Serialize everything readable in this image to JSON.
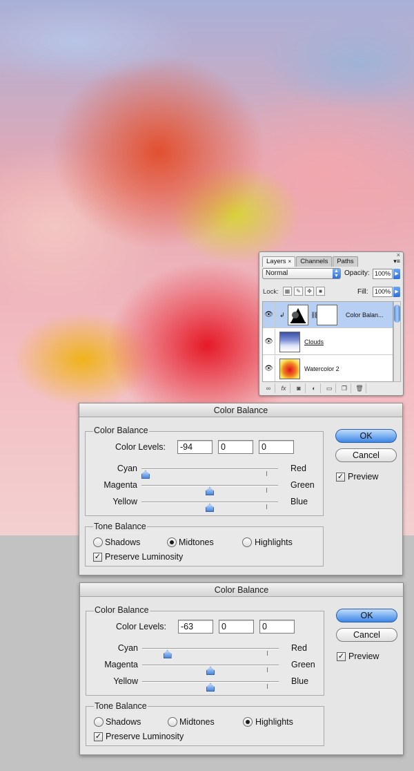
{
  "layers_panel": {
    "tabs": [
      "Layers",
      "Channels",
      "Paths"
    ],
    "tab_close": "×",
    "menu": "▾≡",
    "close": "×",
    "blend_mode": "Normal",
    "opacity_label": "Opacity:",
    "opacity_value": "100%",
    "lock_label": "Lock:",
    "fill_label": "Fill:",
    "fill_value": "100%",
    "layers": [
      {
        "name": "Color Balan...",
        "selected": true
      },
      {
        "name": "Clouds",
        "selected": false
      },
      {
        "name": "Watercolor 2",
        "selected": false
      }
    ]
  },
  "dialogs": [
    {
      "title": "Color Balance",
      "group_label": "Color Balance",
      "levels_label": "Color Levels:",
      "levels": [
        "-94",
        "0",
        "0"
      ],
      "sliders": [
        {
          "left": "Cyan",
          "right": "Red",
          "value": -94
        },
        {
          "left": "Magenta",
          "right": "Green",
          "value": 0
        },
        {
          "left": "Yellow",
          "right": "Blue",
          "value": 0
        }
      ],
      "ok_label": "OK",
      "cancel_label": "Cancel",
      "preview_label": "Preview",
      "preview_checked": true,
      "tone_label": "Tone Balance",
      "tones": [
        "Shadows",
        "Midtones",
        "Highlights"
      ],
      "selected_tone": "Midtones",
      "preserve_label": "Preserve Luminosity",
      "preserve_checked": true
    },
    {
      "title": "Color Balance",
      "group_label": "Color Balance",
      "levels_label": "Color Levels:",
      "levels": [
        "-63",
        "0",
        "0"
      ],
      "sliders": [
        {
          "left": "Cyan",
          "right": "Red",
          "value": -63
        },
        {
          "left": "Magenta",
          "right": "Green",
          "value": 0
        },
        {
          "left": "Yellow",
          "right": "Blue",
          "value": 0
        }
      ],
      "ok_label": "OK",
      "cancel_label": "Cancel",
      "preview_label": "Preview",
      "preview_checked": true,
      "tone_label": "Tone Balance",
      "tones": [
        "Shadows",
        "Midtones",
        "Highlights"
      ],
      "selected_tone": "Highlights",
      "preserve_label": "Preserve Luminosity",
      "preserve_checked": true
    }
  ]
}
